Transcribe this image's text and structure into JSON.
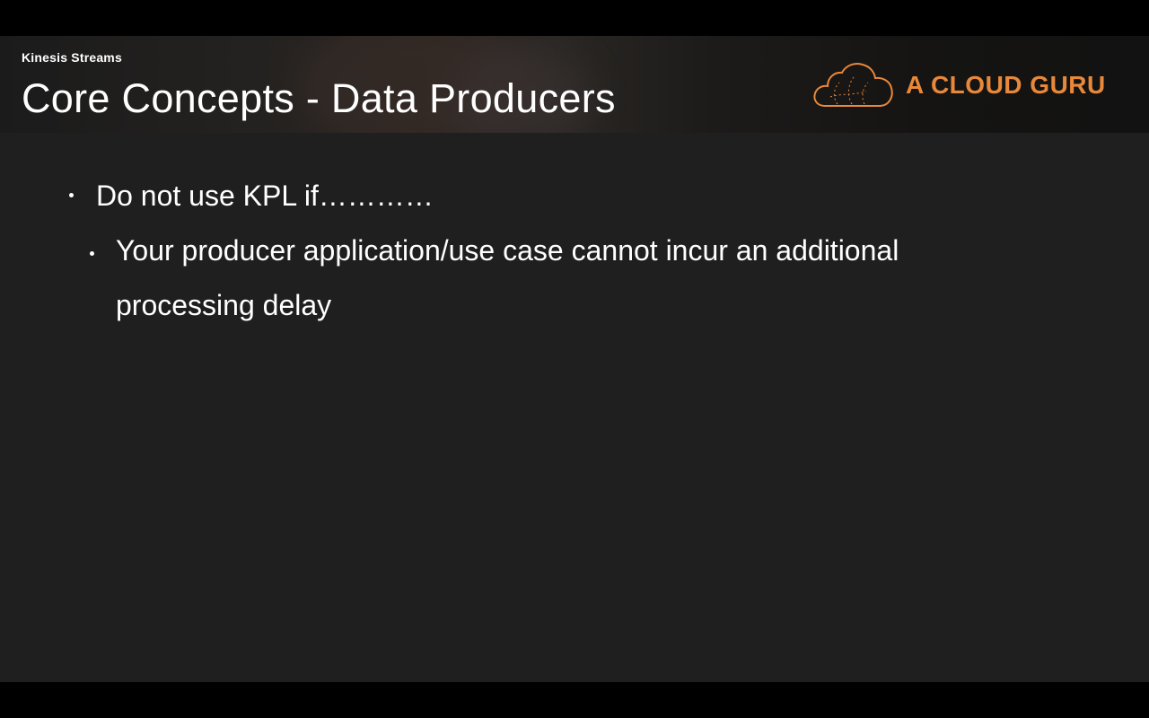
{
  "header": {
    "kicker": "Kinesis Streams",
    "title": "Core Concepts - Data Producers"
  },
  "logo": {
    "text": "A CLOUD GURU",
    "icon": "cloud-icon",
    "color": "#e8883a"
  },
  "bullets": [
    {
      "level": 1,
      "text": "Do not use KPL if…………"
    },
    {
      "level": 2,
      "text": "Your producer application/use case cannot incur an additional processing delay"
    }
  ],
  "colors": {
    "background": "#1f1f1f",
    "text": "#ffffff",
    "accent": "#e8883a"
  }
}
